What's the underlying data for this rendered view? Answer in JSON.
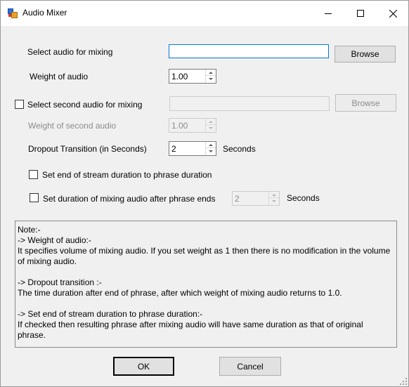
{
  "window": {
    "title": "Audio Mixer"
  },
  "form": {
    "select_audio_label": "Select audio for mixing",
    "select_audio_value": "",
    "browse_label": "Browse",
    "weight_label": "Weight of audio",
    "weight_value": "1.00",
    "second_audio_label": "Select second audio for mixing",
    "second_audio_checked": false,
    "second_audio_value": "",
    "browse2_label": "Browse",
    "weight2_label": "Weight of second audio",
    "weight2_value": "1.00",
    "dropout_label": "Dropout Transition (in Seconds)",
    "dropout_value": "2",
    "dropout_unit": "Seconds",
    "end_stream_label": "Set end of stream duration to phrase duration",
    "end_stream_checked": false,
    "mix_duration_label": "Set duration of mixing audio after phrase ends",
    "mix_duration_checked": false,
    "mix_duration_value": "2",
    "mix_duration_unit": "Seconds"
  },
  "note": {
    "lines": [
      "Note:-",
      "-> Weight of audio:-",
      "It specifies volume of mixing audio. If you set weight as 1 then there is no modification in the volume",
      "of mixing audio.",
      "",
      "-> Dropout transition :-",
      "The time duration after end of phrase, after which weight of mixing audio returns to 1.0.",
      "",
      "-> Set end of stream duration to phrase duration:-",
      "If checked then resulting phrase after mixing audio will have same duration as that of original",
      "phrase."
    ]
  },
  "buttons": {
    "ok_label": "OK",
    "cancel_label": "Cancel"
  }
}
